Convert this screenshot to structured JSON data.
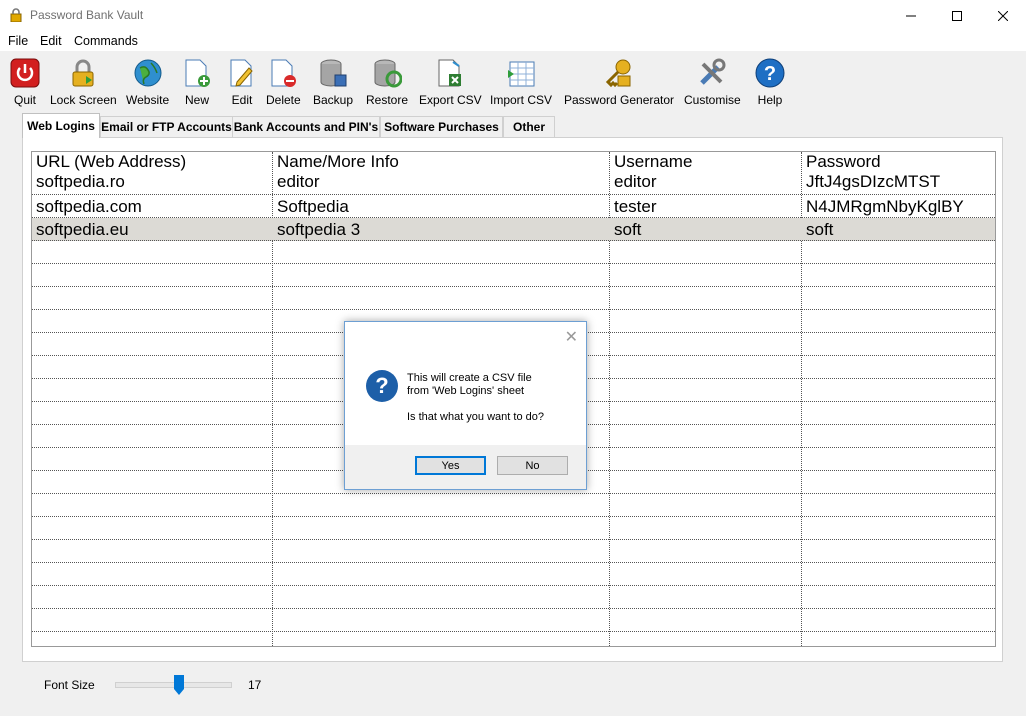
{
  "window": {
    "title": "Password Bank Vault"
  },
  "menu": [
    {
      "label": "File"
    },
    {
      "label": "Edit"
    },
    {
      "label": "Commands"
    }
  ],
  "toolbar": [
    {
      "label": "Quit",
      "icon": "power-icon"
    },
    {
      "label": "Lock Screen",
      "icon": "padlock-icon"
    },
    {
      "label": "Website",
      "icon": "globe-icon"
    },
    {
      "label": "New",
      "icon": "new-document-icon"
    },
    {
      "label": "Edit",
      "icon": "edit-document-icon"
    },
    {
      "label": "Delete",
      "icon": "delete-document-icon"
    },
    {
      "label": "Backup",
      "icon": "database-save-icon"
    },
    {
      "label": "Restore",
      "icon": "database-restore-icon"
    },
    {
      "label": "Export CSV",
      "icon": "export-csv-icon"
    },
    {
      "label": "Import CSV",
      "icon": "import-csv-icon"
    },
    {
      "label": "Password Generator",
      "icon": "key-lock-icon"
    },
    {
      "label": "Customise",
      "icon": "tools-icon"
    },
    {
      "label": "Help",
      "icon": "help-icon"
    }
  ],
  "tabs": [
    {
      "label": "Web Logins",
      "active": true
    },
    {
      "label": "Email or FTP Accounts"
    },
    {
      "label": "Bank Accounts and PIN's"
    },
    {
      "label": "Software Purchases"
    },
    {
      "label": "Other"
    }
  ],
  "table": {
    "columns": [
      "URL (Web Address)",
      "Name/More Info",
      "Username",
      "Password"
    ],
    "rows": [
      [
        "softpedia.ro",
        "editor",
        "editor",
        "JftJ4gsDIzcMTST"
      ],
      [
        "softpedia.com",
        "Softpedia",
        "tester",
        "N4JMRgmNbyKglBY"
      ],
      [
        "softpedia.eu",
        "softpedia 3",
        "soft",
        "soft"
      ]
    ],
    "selected_row": 2
  },
  "dialog": {
    "line1": "This will create a CSV file",
    "line2": "from 'Web Logins' sheet",
    "line3": "Is that what you want to do?",
    "yes": "Yes",
    "no": "No",
    "icon": "question-icon"
  },
  "footer": {
    "font_size_label": "Font Size",
    "font_size_value": "17",
    "slider_fraction": 0.55
  },
  "colors": {
    "selected_row": "#dcdad5",
    "dialog_icon": "#1d5fa8",
    "focus_border": "#0078d7"
  }
}
